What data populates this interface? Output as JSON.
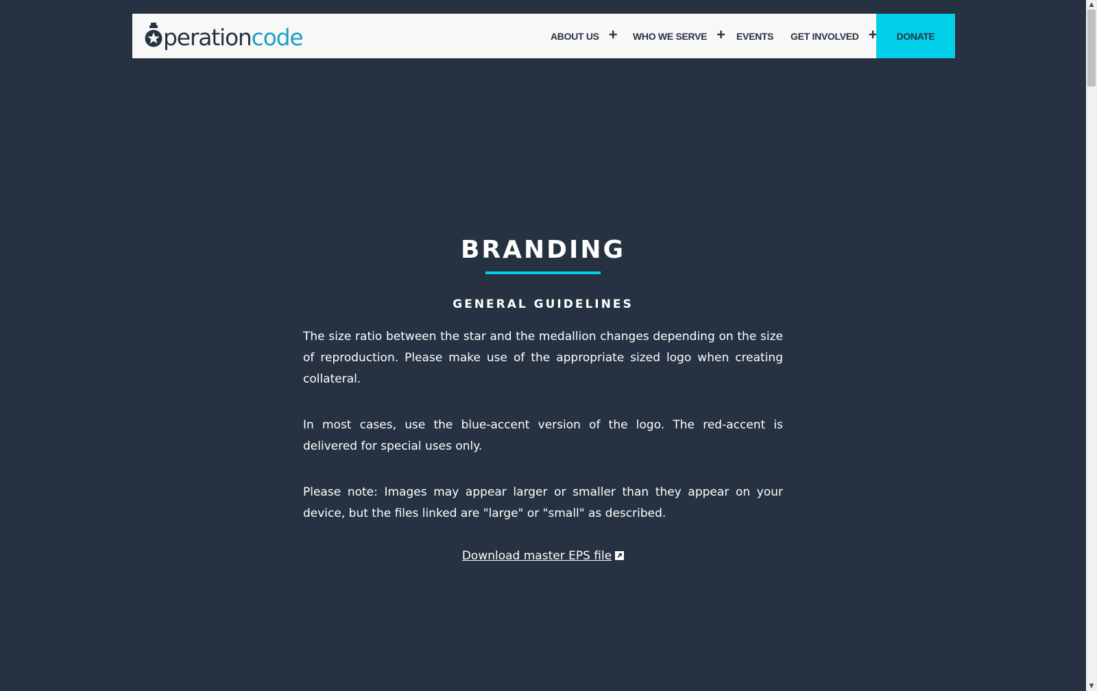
{
  "header": {
    "logo": {
      "dark_text": "peration",
      "accent_text": "code",
      "icon": "medallion-star-icon"
    },
    "nav": [
      {
        "label": "ABOUT US",
        "has_submenu": true
      },
      {
        "label": "WHO WE SERVE",
        "has_submenu": true
      },
      {
        "label": "EVENTS",
        "has_submenu": false
      },
      {
        "label": "GET INVOLVED",
        "has_submenu": true
      }
    ],
    "plus_symbol": "+",
    "donate_label": "DONATE"
  },
  "main": {
    "title": "BRANDING",
    "subtitle": "GENERAL GUIDELINES",
    "paragraphs": [
      "The size ratio between the star and the medallion changes depending on the size of reproduction. Please make use of the appropriate sized logo when creating collateral.",
      "In most cases, use the blue-accent version of the logo. The red-accent is delivered for special uses only.",
      "Please note: Images may appear larger or smaller than they appear on your device, but the files linked are \"large\" or \"small\" as described."
    ],
    "download_link": "Download master EPS file",
    "download_icon": "external-link-icon"
  },
  "colors": {
    "background": "#263241",
    "accent": "#00d1e8",
    "logo_accent": "#1f9ec0",
    "header_bg": "#f8f8f8"
  }
}
